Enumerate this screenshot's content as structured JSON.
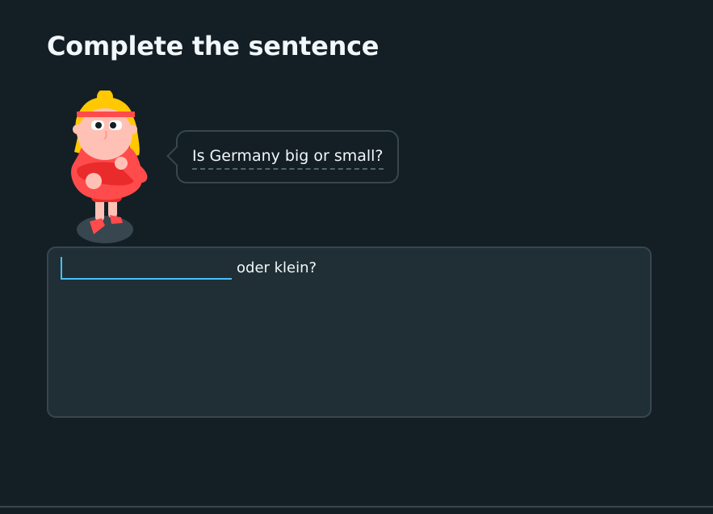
{
  "challenge": {
    "title": "Complete the sentence"
  },
  "speech_bubble": {
    "text": "Is Germany big or small?"
  },
  "answer": {
    "input_value": "",
    "sentence_rest": "oder klein?"
  },
  "character": {
    "icon": "woman-character-icon"
  },
  "colors": {
    "background": "#131f24",
    "panel": "#202f36",
    "border": "#37464f",
    "text": "#f1f7fb",
    "accent_blue": "#49c0f8"
  }
}
